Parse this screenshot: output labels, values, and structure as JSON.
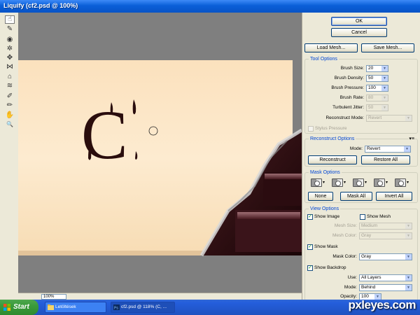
{
  "window": {
    "title": "Liquify (cf2.psd @ 100%)"
  },
  "tools": [
    {
      "name": "forward-warp-icon",
      "glyph": "☝"
    },
    {
      "name": "reconstruct-icon",
      "glyph": "✎"
    },
    {
      "name": "twirl-icon",
      "glyph": "◉"
    },
    {
      "name": "pucker-icon",
      "glyph": "✲"
    },
    {
      "name": "bloat-icon",
      "glyph": "✥"
    },
    {
      "name": "push-left-icon",
      "glyph": "⋈"
    },
    {
      "name": "mirror-icon",
      "glyph": "⌂"
    },
    {
      "name": "turbulence-icon",
      "glyph": "≋"
    },
    {
      "name": "freeze-mask-icon",
      "glyph": "✐"
    },
    {
      "name": "thaw-mask-icon",
      "glyph": "✏"
    },
    {
      "name": "hand-icon",
      "glyph": "✋"
    },
    {
      "name": "zoom-icon",
      "glyph": "🔍"
    }
  ],
  "canvas": {
    "letter": "C",
    "zoom": "100%"
  },
  "buttons": {
    "ok": "OK",
    "cancel": "Cancel",
    "load_mesh": "Load Mesh...",
    "save_mesh": "Save Mesh..."
  },
  "tool_options": {
    "legend": "Tool Options",
    "brush_size": {
      "label": "Brush Size:",
      "value": "20"
    },
    "brush_density": {
      "label": "Brush Density:",
      "value": "50"
    },
    "brush_pressure": {
      "label": "Brush Pressure:",
      "value": "100"
    },
    "brush_rate": {
      "label": "Brush Rate:",
      "value": "80"
    },
    "turbulent_jitter": {
      "label": "Turbulent Jitter:",
      "value": "50"
    },
    "reconstruct_mode": {
      "label": "Reconstruct Mode:",
      "value": "Revert"
    },
    "stylus_pressure": "Stylus Pressure"
  },
  "reconstruct_options": {
    "legend": "Reconstruct Options",
    "mode": {
      "label": "Mode:",
      "value": "Revert"
    },
    "reconstruct_btn": "Reconstruct",
    "restore_all_btn": "Restore All"
  },
  "mask_options": {
    "legend": "Mask Options",
    "none_btn": "None",
    "mask_all_btn": "Mask All",
    "invert_all_btn": "Invert All"
  },
  "view_options": {
    "legend": "View Options",
    "show_image": "Show Image",
    "show_mesh": "Show Mesh",
    "mesh_size": {
      "label": "Mesh Size:",
      "value": "Medium"
    },
    "mesh_color": {
      "label": "Mesh Color:",
      "value": "Gray"
    },
    "show_mask": "Show Mask",
    "mask_color": {
      "label": "Mask Color:",
      "value": "Gray"
    },
    "show_backdrop": "Show Backdrop",
    "use": {
      "label": "Use:",
      "value": "All Layers"
    },
    "mode": {
      "label": "Mode:",
      "value": "Behind"
    },
    "opacity": {
      "label": "Opacity:",
      "value": "100"
    }
  },
  "taskbar": {
    "start": "Start",
    "tasks": [
      "Letöltések",
      "cf2.psd @ 118% (C, ..."
    ]
  },
  "watermark": "pxleyes.com",
  "colors": {
    "titlebar": "#0a5fd8",
    "paper": "#fbe5c3",
    "chocolate": "#2a0d0d",
    "accent_legend": "#0046d5"
  }
}
